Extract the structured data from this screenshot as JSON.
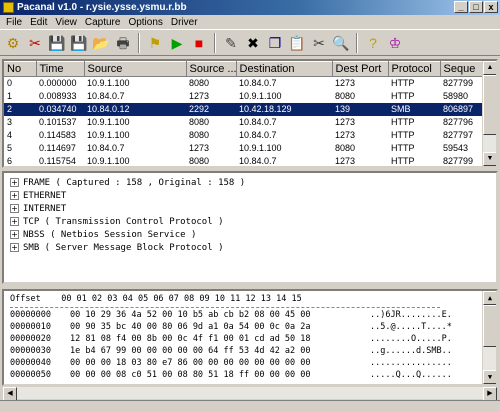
{
  "window": {
    "title": "Pacanal v1.0 - r.ysie.ysse.ysmu.r.bb",
    "min": "_",
    "max": "□",
    "close": "x"
  },
  "menu": [
    "File",
    "Edit",
    "View",
    "Capture",
    "Options",
    "Driver"
  ],
  "toolbar": {
    "buttons": [
      {
        "name": "open-adapter-icon",
        "glyph": "⚙",
        "color": "#b08000"
      },
      {
        "name": "delete-icon",
        "glyph": "✂",
        "color": "#c00000"
      },
      {
        "name": "save-icon",
        "glyph": "💾",
        "color": "#000080"
      },
      {
        "name": "save-as-icon",
        "glyph": "💾",
        "color": "#000080"
      },
      {
        "name": "open-file-icon",
        "glyph": "📂",
        "color": "#c08000"
      },
      {
        "name": "print-icon",
        "glyph": "🖶",
        "color": "#404040"
      },
      {
        "name": "filter-icon",
        "glyph": "⚑",
        "color": "#c0a000"
      },
      {
        "name": "start-capture-icon",
        "glyph": "▶",
        "color": "#00a000"
      },
      {
        "name": "stop-capture-icon",
        "glyph": "■",
        "color": "#e00000"
      },
      {
        "name": "edit-icon",
        "glyph": "✎",
        "color": "#404040"
      },
      {
        "name": "close-icon",
        "glyph": "✖",
        "color": "#000000"
      },
      {
        "name": "copy-icon",
        "glyph": "❐",
        "color": "#000080"
      },
      {
        "name": "paste-icon",
        "glyph": "📋",
        "color": "#806000"
      },
      {
        "name": "cut-icon",
        "glyph": "✂",
        "color": "#404040"
      },
      {
        "name": "find-icon",
        "glyph": "🔍",
        "color": "#404040"
      },
      {
        "name": "help-icon",
        "glyph": "?",
        "color": "#c0a000"
      },
      {
        "name": "about-icon",
        "glyph": "♔",
        "color": "#a000a0"
      }
    ]
  },
  "packet_list": {
    "columns": [
      "No",
      "Time",
      "Source",
      "Source ...",
      "Destination",
      "Dest Port",
      "Protocol",
      "Seque"
    ],
    "rows": [
      [
        "0",
        "0.000000",
        "10.9.1.100",
        "8080",
        "10.84.0.7",
        "1273",
        "HTTP",
        "827799"
      ],
      [
        "1",
        "0.008933",
        "10.84.0.7",
        "1273",
        "10.9.1.100",
        "8080",
        "HTTP",
        "58980"
      ],
      [
        "2",
        "0.034740",
        "10.84.0.12",
        "2292",
        "10.42.18.129",
        "139",
        "SMB",
        "806897"
      ],
      [
        "3",
        "0.101537",
        "10.9.1.100",
        "8080",
        "10.84.0.7",
        "1273",
        "HTTP",
        "827796"
      ],
      [
        "4",
        "0.114583",
        "10.9.1.100",
        "8080",
        "10.84.0.7",
        "1273",
        "HTTP",
        "827797"
      ],
      [
        "5",
        "0.114697",
        "10.84.0.7",
        "1273",
        "10.9.1.100",
        "8080",
        "HTTP",
        "59543"
      ],
      [
        "6",
        "0.115754",
        "10.9.1.100",
        "8080",
        "10.84.0.7",
        "1273",
        "HTTP",
        "827799"
      ]
    ],
    "selected_index": 2
  },
  "tree": [
    "FRAME ( Captured : 158 , Original : 158 )",
    "ETHERNET",
    "INTERNET",
    "TCP ( Transmission Control Protocol )",
    "NBSS ( Netbios Session Service )",
    "SMB ( Server Message Block Protocol )"
  ],
  "hex": {
    "header_offset": "Offset",
    "header_bytes": "00 01 02 03 04 05 06 07 08 09 10 11 12 13 14 15",
    "lines": [
      {
        "offset": "00000000",
        "bytes": "00 10 29 36 4a 52 00 10 b5 ab cb b2 08 00 45 00",
        "ascii": "..)6JR........E."
      },
      {
        "offset": "00000010",
        "bytes": "00 90 35 bc 40 00 80 06 9d a1 0a 54 00 0c 0a 2a",
        "ascii": "..5.@.....T....*"
      },
      {
        "offset": "00000020",
        "bytes": "12 81 08 f4 00 8b 00 0c 4f f1 00 01 cd ad 50 18",
        "ascii": "........O.....P."
      },
      {
        "offset": "00000030",
        "bytes": "1e b4 67 99 00 00 00 00 00 64 ff 53 4d 42 a2 00",
        "ascii": "..g......d.SMB.."
      },
      {
        "offset": "00000040",
        "bytes": "00 00 00 18 03 80 e7 86 00 00 00 00 00 00 00 00",
        "ascii": "................"
      },
      {
        "offset": "00000050",
        "bytes": "00 00 00 08 c0 51 00 08 80 51 18 ff 00 00 00 00",
        "ascii": ".....Q...Q......"
      }
    ]
  }
}
